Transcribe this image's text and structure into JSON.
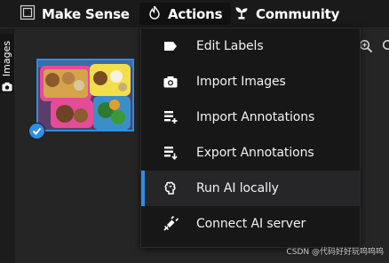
{
  "app": {
    "brand": "Make Sense"
  },
  "nav": {
    "actions_label": "Actions",
    "community_label": "Community"
  },
  "sidebar": {
    "images_tab_label": "Images"
  },
  "actions_menu": {
    "items": [
      {
        "label": "Edit Labels",
        "icon": "label-tag-icon"
      },
      {
        "label": "Import Images",
        "icon": "camera-icon"
      },
      {
        "label": "Import Annotations",
        "icon": "import-annotations-icon"
      },
      {
        "label": "Export Annotations",
        "icon": "export-annotations-icon"
      },
      {
        "label": "Run AI locally",
        "icon": "ai-chip-icon",
        "active": true
      },
      {
        "label": "Connect AI server",
        "icon": "plug-icon"
      }
    ]
  },
  "watermark": "CSDN @代码好好玩呜呜呜",
  "colors": {
    "accent": "#2f8de4",
    "background": "#1c1c1d",
    "menu_background": "#171718",
    "menu_active": "#262628"
  }
}
